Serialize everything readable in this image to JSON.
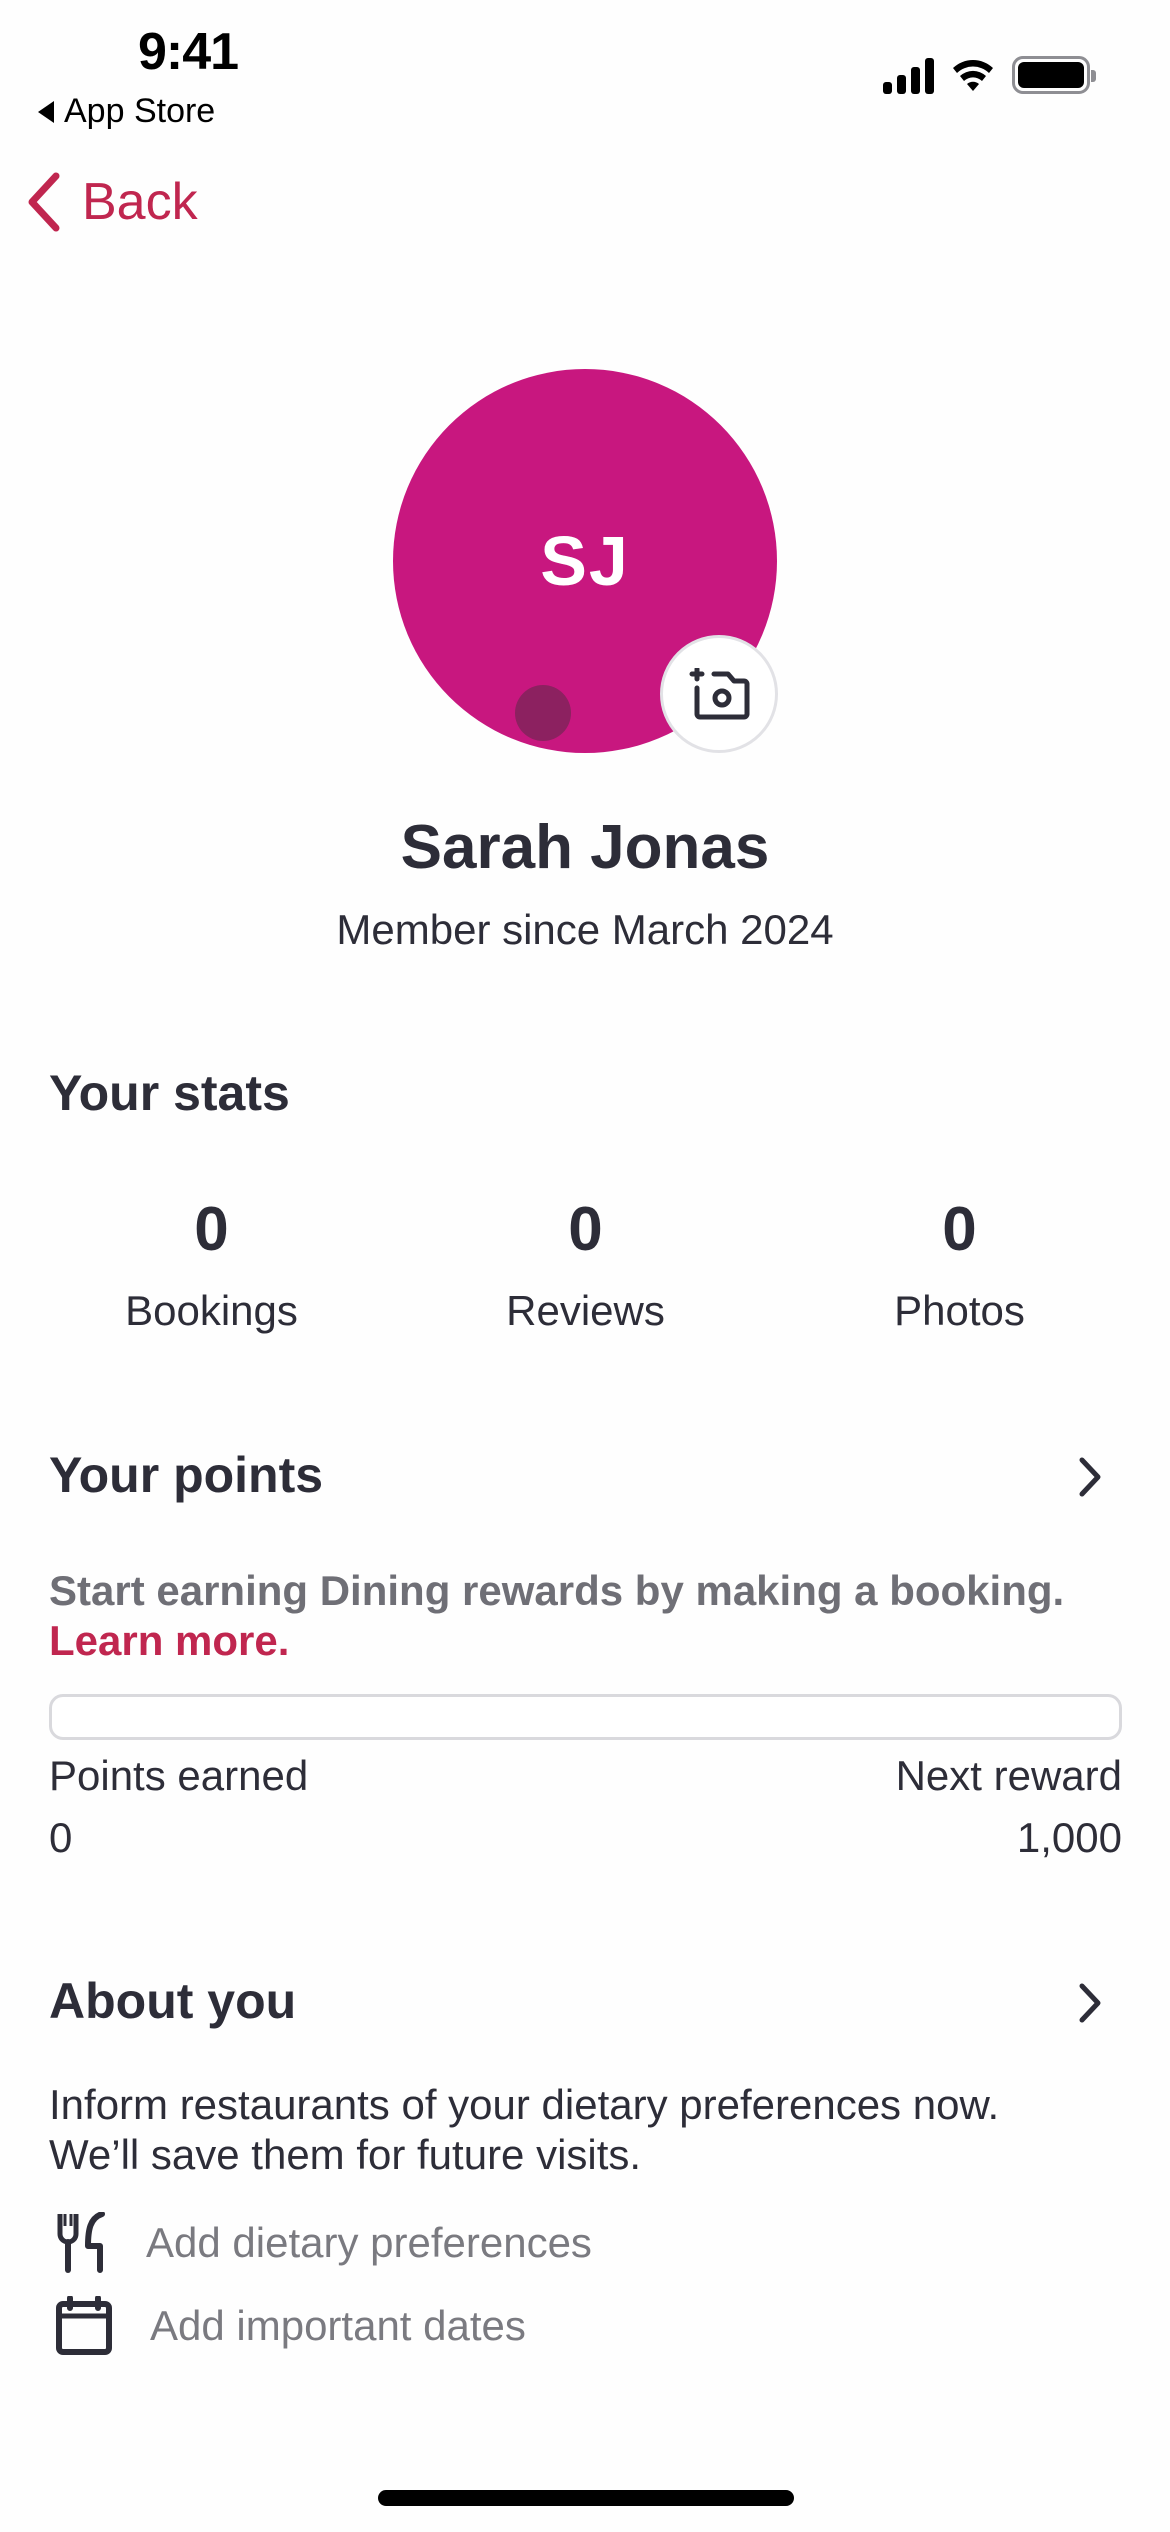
{
  "status_bar": {
    "time": "9:41",
    "back_app": "App Store",
    "icons": [
      "cellular-signal-icon",
      "wifi-icon",
      "battery-icon"
    ]
  },
  "nav": {
    "back_label": "Back",
    "back_icon": "chevron-left-icon"
  },
  "profile": {
    "initials": "SJ",
    "avatar_color": "#c8177f",
    "name": "Sarah Jonas",
    "member_since": "Member since March 2024",
    "camera_icon": "add-photo-camera-icon"
  },
  "stats": {
    "title": "Your stats",
    "items": [
      {
        "value": "0",
        "label": "Bookings"
      },
      {
        "value": "0",
        "label": "Reviews"
      },
      {
        "value": "0",
        "label": "Photos"
      }
    ]
  },
  "points": {
    "title": "Your points",
    "description": "Start earning Dining rewards by making a booking.",
    "learn_more": "Learn more.",
    "progress_fraction": 0,
    "earned_label": "Points earned",
    "earned_value": "0",
    "next_label": "Next reward",
    "next_value": "1,000"
  },
  "about": {
    "title": "About you",
    "description_line1": "Inform restaurants of your dietary preferences now.",
    "description_line2": "We’ll save them for future visits.",
    "items": [
      {
        "icon": "fork-knife-icon",
        "label": "Add dietary preferences"
      },
      {
        "icon": "calendar-icon",
        "label": "Add important dates"
      }
    ]
  },
  "colors": {
    "accent": "#c0264f",
    "text": "#2d2d38",
    "muted": "#6f6f76"
  }
}
